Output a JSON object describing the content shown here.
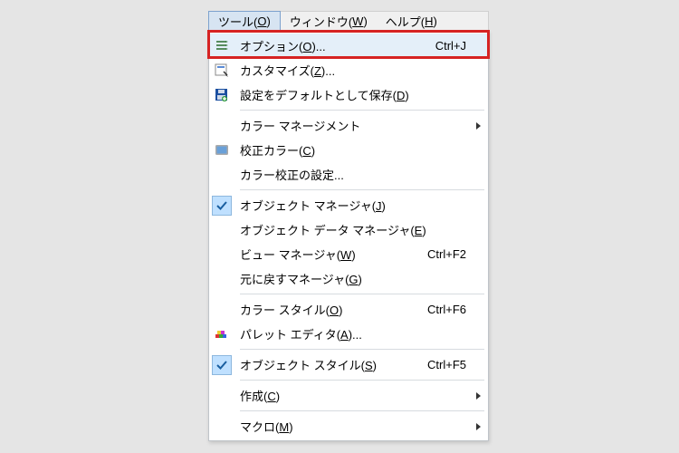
{
  "menubar": {
    "items": [
      {
        "pre": "ツール(",
        "u": "O",
        "post": ")"
      },
      {
        "pre": "ウィンドウ(",
        "u": "W",
        "post": ")"
      },
      {
        "pre": "ヘルプ(",
        "u": "H",
        "post": ")"
      }
    ]
  },
  "dropdown": {
    "items": [
      {
        "icon": "options-icon",
        "pre": "オプション(",
        "u": "O",
        "post": ")...",
        "shortcut": "Ctrl+J",
        "highlighted": true
      },
      {
        "icon": "customize-icon",
        "pre": "カスタマイズ(",
        "u": "Z",
        "post": ")...",
        "shortcut": ""
      },
      {
        "icon": "save-icon",
        "pre": "設定をデフォルトとして保存(",
        "u": "D",
        "post": ")",
        "shortcut": ""
      },
      {
        "sep": true
      },
      {
        "icon": "",
        "pre": "カラー マネージメント",
        "u": "",
        "post": "",
        "shortcut": "",
        "submenu": true
      },
      {
        "icon": "proof-icon",
        "pre": "校正カラー(",
        "u": "C",
        "post": ")",
        "shortcut": ""
      },
      {
        "icon": "",
        "pre": "カラー校正の設定...",
        "u": "",
        "post": "",
        "shortcut": ""
      },
      {
        "sep": true
      },
      {
        "icon": "check-icon",
        "pre": "オブジェクト マネージャ(",
        "u": "J",
        "post": ")",
        "shortcut": ""
      },
      {
        "icon": "",
        "pre": "オブジェクト データ マネージャ(",
        "u": "E",
        "post": ")",
        "shortcut": ""
      },
      {
        "icon": "",
        "pre": "ビュー マネージャ(",
        "u": "W",
        "post": ")",
        "shortcut": "Ctrl+F2"
      },
      {
        "icon": "",
        "pre": "元に戻すマネージャ(",
        "u": "G",
        "post": ")",
        "shortcut": ""
      },
      {
        "sep": true
      },
      {
        "icon": "",
        "pre": "カラー スタイル(",
        "u": "O",
        "post": ")",
        "shortcut": "Ctrl+F6"
      },
      {
        "icon": "palette-icon",
        "pre": "パレット エディタ(",
        "u": "A",
        "post": ")...",
        "shortcut": ""
      },
      {
        "sep": true
      },
      {
        "icon": "check-icon",
        "pre": "オブジェクト スタイル(",
        "u": "S",
        "post": ")",
        "shortcut": "Ctrl+F5"
      },
      {
        "sep": true
      },
      {
        "icon": "",
        "pre": "作成(",
        "u": "C",
        "post": ")",
        "shortcut": "",
        "submenu": true
      },
      {
        "sep": true
      },
      {
        "icon": "",
        "pre": "マクロ(",
        "u": "M",
        "post": ")",
        "shortcut": "",
        "submenu": true
      }
    ]
  }
}
